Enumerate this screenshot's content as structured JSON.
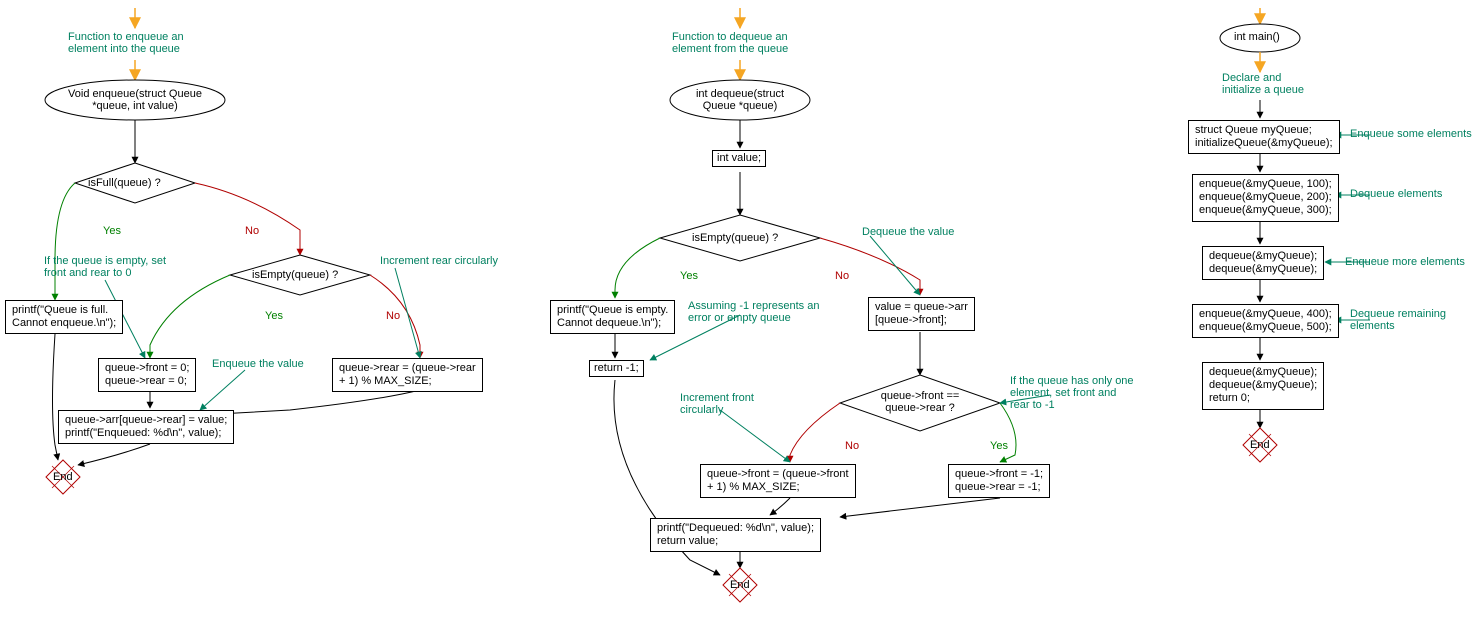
{
  "flowchart1": {
    "title_comment": "Function to enqueue an\nelement into the queue",
    "terminator": "Void enqueue(struct Queue\n*queue, int value)",
    "decision1": "isFull(queue) ?",
    "branch_yes1": "Yes",
    "branch_no1": "No",
    "comment_yes1": "If the queue is empty, set\nfront and rear to 0",
    "box_full": "printf(\"Queue is full.\nCannot enqueue.\\n\");",
    "decision2": "isEmpty(queue) ?",
    "branch_yes2": "Yes",
    "branch_no2": "No",
    "comment_no2": "Increment rear circularly",
    "box_setzero": "queue->front = 0;\nqueue->rear = 0;",
    "box_increar": "queue->rear = (queue->rear\n+ 1) % MAX_SIZE;",
    "comment_enq": "Enqueue the value",
    "box_enq": "queue->arr[queue->rear] = value;\nprintf(\"Enqueued: %d\\n\", value);",
    "end": "End"
  },
  "flowchart2": {
    "title_comment": "Function to dequeue an\nelement from the queue",
    "terminator": "int dequeue(struct\nQueue *queue)",
    "box_int": "int value;",
    "decision1": "isEmpty(queue) ?",
    "branch_yes1": "Yes",
    "branch_no1": "No",
    "box_empty": "printf(\"Queue is empty.\nCannot dequeue.\\n\");",
    "comment_assume": "Assuming -1 represents an\nerror or empty queue",
    "box_return_minus1": "return -1;",
    "comment_dequeue_value": "Dequeue the value",
    "box_value": "value = queue->arr\n[queue->front];",
    "decision2": "queue->front ==\nqueue->rear ?",
    "branch_yes2": "Yes",
    "branch_no2": "No",
    "comment_only_one": "If the queue has only one\nelement, set front and\nrear to -1",
    "box_incfront": "queue->front = (queue->front\n+ 1) % MAX_SIZE;",
    "box_reset": "queue->front = -1;\nqueue->rear = -1;",
    "comment_incfront": "Increment front\ncircularly",
    "box_print_return": "printf(\"Dequeued: %d\\n\", value);\nreturn value;",
    "end": "End"
  },
  "flowchart3": {
    "terminator": "int main()",
    "comment_declare": "Declare and\ninitialize a queue",
    "box_declare": "struct Queue myQueue;\ninitializeQueue(&myQueue);",
    "comment_enq_some": "Enqueue some elements",
    "box_enq3": "enqueue(&myQueue, 100);\nenqueue(&myQueue, 200);\nenqueue(&myQueue, 300);",
    "comment_deq": "Dequeue elements",
    "box_deq2": "dequeue(&myQueue);\ndequeue(&myQueue);",
    "comment_enq_more": "Enqueue more elements",
    "box_enq2": "enqueue(&myQueue, 400);\nenqueue(&myQueue, 500);",
    "comment_deq_remain": "Dequeue remaining\nelements",
    "box_final": "dequeue(&myQueue);\ndequeue(&myQueue);\nreturn 0;",
    "end": "End"
  }
}
